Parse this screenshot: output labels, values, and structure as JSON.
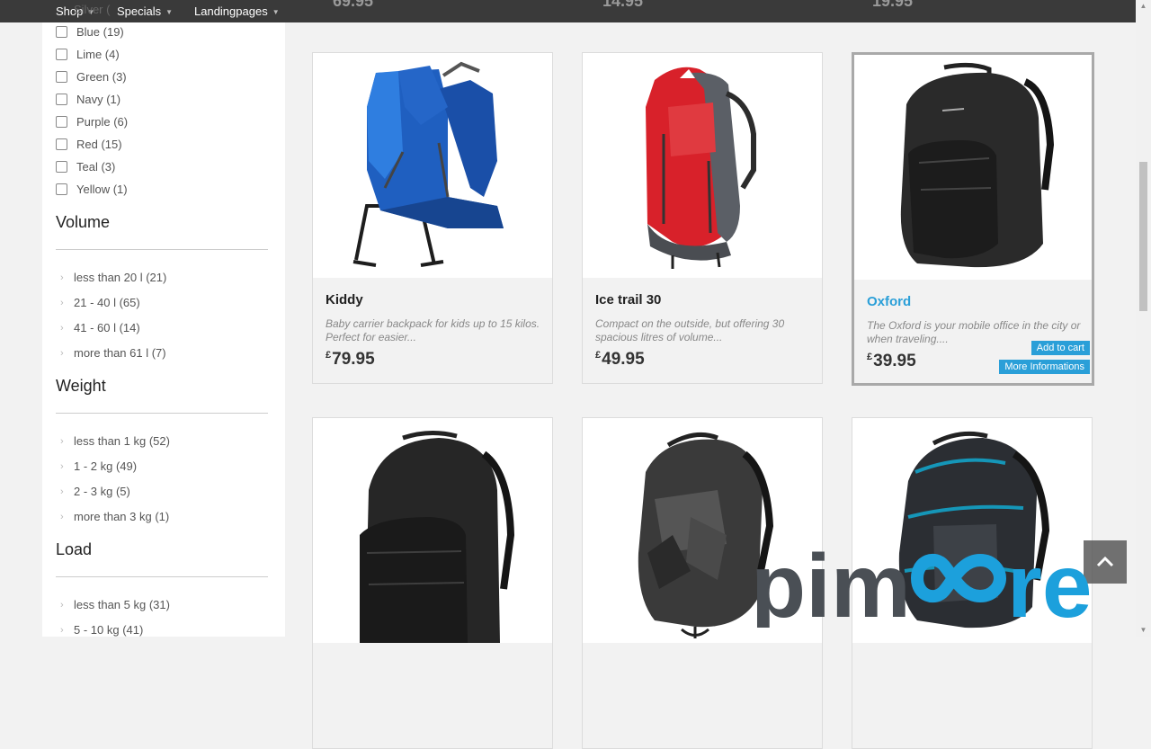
{
  "nav": {
    "items": [
      {
        "label": "Shop"
      },
      {
        "label": "Specials"
      },
      {
        "label": "Landingpages"
      }
    ],
    "bleed_filter_text": "Silver (",
    "bleed_prices": [
      "69.95",
      "14.95",
      "19.95"
    ]
  },
  "sidebar": {
    "colors": [
      {
        "label": "Blue (19)"
      },
      {
        "label": "Lime (4)"
      },
      {
        "label": "Green (3)"
      },
      {
        "label": "Navy (1)"
      },
      {
        "label": "Purple (6)"
      },
      {
        "label": "Red (15)"
      },
      {
        "label": "Teal (3)"
      },
      {
        "label": "Yellow (1)"
      }
    ],
    "volume": {
      "heading": "Volume",
      "items": [
        "less than 20 l (21)",
        "21 - 40 l (65)",
        "41 - 60 l (14)",
        "more than 61 l (7)"
      ]
    },
    "weight": {
      "heading": "Weight",
      "items": [
        "less than 1 kg (52)",
        "1 - 2 kg (49)",
        "2 - 3 kg (5)",
        "more than 3 kg (1)"
      ]
    },
    "load": {
      "heading": "Load",
      "items": [
        "less than 5 kg (31)",
        "5 - 10 kg (41)"
      ]
    }
  },
  "products": [
    {
      "name": "Kiddy",
      "description": "Baby carrier backpack for kids up to 15 kilos. Perfect for easier...",
      "currency": "£",
      "price": "79.95",
      "image": "blue-child-carrier"
    },
    {
      "name": "Ice trail 30",
      "description": "Compact on the outside, but offering 30 spacious litres of volume...",
      "currency": "£",
      "price": "49.95",
      "image": "red-trekking-backpack"
    },
    {
      "name": "Oxford",
      "description": "The Oxford is your mobile office in the city or when traveling....",
      "currency": "£",
      "price": "39.95",
      "image": "black-office-backpack",
      "add_to_cart": "Add to cart",
      "more_info": "More Informations"
    },
    {
      "image": "black-backpack"
    },
    {
      "image": "grey-camo-backpack"
    },
    {
      "image": "black-teal-backpack"
    }
  ],
  "logo": {
    "text": "pimcore",
    "colors": {
      "dark": "#4a4f55",
      "blue": "#1ca0dc"
    }
  },
  "colors": {
    "accent": "#2a9fd8",
    "nav": "#3a3a3a"
  }
}
